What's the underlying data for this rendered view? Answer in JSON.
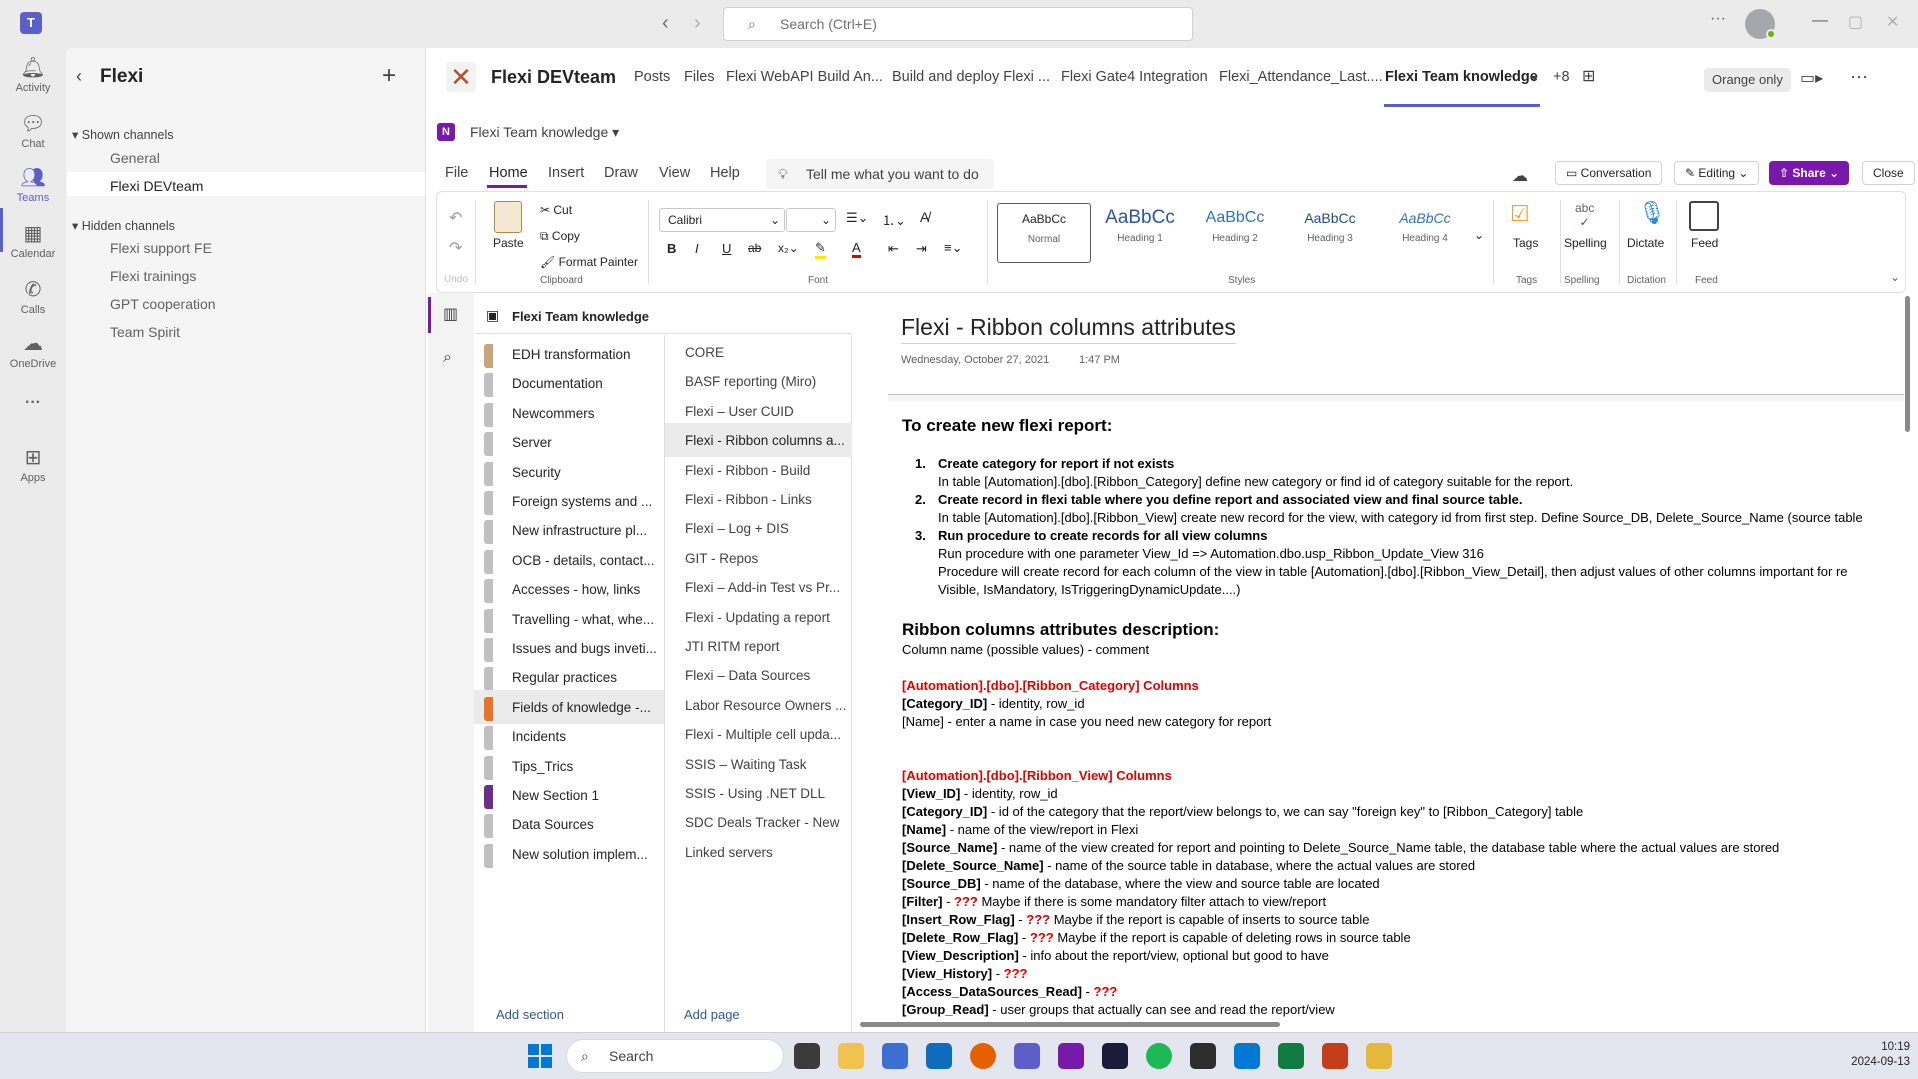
{
  "titlebar": {
    "search_placeholder": "Search (Ctrl+E)",
    "more": "···"
  },
  "rail": [
    {
      "label": "Activity",
      "icon": "bell-icon"
    },
    {
      "label": "Chat",
      "icon": "chat-icon"
    },
    {
      "label": "Teams",
      "icon": "teams-icon"
    },
    {
      "label": "Calendar",
      "icon": "calendar-icon"
    },
    {
      "label": "Calls",
      "icon": "phone-icon"
    },
    {
      "label": "OneDrive",
      "icon": "cloud-icon"
    },
    {
      "label": "···",
      "icon": "more-icon"
    },
    {
      "label": "Apps",
      "icon": "add-app-icon"
    }
  ],
  "team": {
    "name": "Flexi",
    "shown_header": "Shown channels",
    "shown_channels": [
      "General",
      "Flexi DEVteam"
    ],
    "hidden_header": "Hidden channels",
    "hidden_channels": [
      "Flexi support FE",
      "Flexi trainings",
      "GPT cooperation",
      "Team Spirit"
    ]
  },
  "channel": {
    "title": "Flexi DEVteam",
    "tabs": [
      "Posts",
      "Files",
      "Flexi WebAPI Build An...",
      "Build and deploy Flexi ...",
      "Flexi Gate4 Integration",
      "Flexi_Attendance_Last....",
      "Flexi Team knowledge",
      "+8"
    ],
    "orange_only": "Orange only"
  },
  "onenote": {
    "notebook_title": "Flexi Team knowledge",
    "menu": [
      "File",
      "Home",
      "Insert",
      "Draw",
      "View",
      "Help"
    ],
    "tell_me": "Tell me what you want to do",
    "conversation": "Conversation",
    "editing": "Editing",
    "share": "Share",
    "close": "Close",
    "ribbon": {
      "undo_label": "Undo",
      "paste": "Paste",
      "cut": "Cut",
      "copy": "Copy",
      "format_painter": "Format Painter",
      "clipboard": "Clipboard",
      "font_name": "Calibri",
      "font": "Font",
      "styles": [
        {
          "preview": "AaBbCc",
          "name": "Normal"
        },
        {
          "preview": "AaBbCc",
          "name": "Heading 1"
        },
        {
          "preview": "AaBbCc",
          "name": "Heading 2"
        },
        {
          "preview": "AaBbCc",
          "name": "Heading 3"
        },
        {
          "preview": "AaBbCc",
          "name": "Heading 4"
        }
      ],
      "styles_label": "Styles",
      "tags": "Tags",
      "spelling": "Spelling",
      "spelling_icon_text": "abc",
      "dictate": "Dictate",
      "dictation": "Dictation",
      "feed": "Feed"
    },
    "notebook_header": "Flexi Team knowledge",
    "sections": [
      {
        "name": "EDH transformation",
        "color": "#c8a47c"
      },
      {
        "name": "Documentation",
        "color": "#c0c0c0"
      },
      {
        "name": "Newcommers",
        "color": "#c0c0c0"
      },
      {
        "name": "Server",
        "color": "#c0c0c0"
      },
      {
        "name": "Security",
        "color": "#c0c0c0"
      },
      {
        "name": "Foreign systems and ...",
        "color": "#c0c0c0"
      },
      {
        "name": "New infrastructure pl...",
        "color": "#c0c0c0"
      },
      {
        "name": "OCB - details, contact...",
        "color": "#c0c0c0"
      },
      {
        "name": "Accesses - how, links",
        "color": "#c0c0c0"
      },
      {
        "name": "Travelling - what, whe...",
        "color": "#c0c0c0"
      },
      {
        "name": "Issues and bugs inveti...",
        "color": "#c0c0c0"
      },
      {
        "name": "Regular practices",
        "color": "#c0c0c0"
      },
      {
        "name": "Fields of knowledge -...",
        "color": "#e8742a"
      },
      {
        "name": "Incidents",
        "color": "#c0c0c0"
      },
      {
        "name": "Tips_Trics",
        "color": "#c0c0c0"
      },
      {
        "name": "New Section 1",
        "color": "#6b2e8c"
      },
      {
        "name": "Data Sources",
        "color": "#c0c0c0"
      },
      {
        "name": "New solution implem...",
        "color": "#c0c0c0"
      }
    ],
    "pages": [
      "CORE",
      "BASF reporting (Miro)",
      "Flexi – User CUID",
      "Flexi - Ribbon columns a...",
      "Flexi - Ribbon - Build",
      "Flexi - Ribbon - Links",
      "Flexi – Log + DIS",
      "GIT - Repos",
      "Flexi – Add-in Test vs Pr...",
      "Flexi - Updating a report",
      "JTI RITM report",
      "Flexi – Data Sources",
      "Labor Resource Owners ...",
      "Flexi - Multiple cell upda...",
      "SSIS – Waiting Task",
      "SSIS  - Using .NET DLL",
      "SDC Deals Tracker - New",
      "Linked servers"
    ],
    "add_section": "Add section",
    "add_page": "Add page",
    "page": {
      "title": "Flexi - Ribbon columns attributes",
      "date": "Wednesday, October 27, 2021",
      "time": "1:47 PM",
      "h1": "To create new flexi report:",
      "steps": [
        {
          "n": "1.",
          "title": "Create category for report if not exists",
          "lines": [
            "In table [Automation].[dbo].[Ribbon_Category] define new category or find id of category suitable for the report."
          ]
        },
        {
          "n": "2.",
          "title": "Create record in flexi table where you define report and associated view and final source table.",
          "lines": [
            "In table [Automation].[dbo].[Ribbon_View] create new record for the view, with category id from first step. Define Source_DB, Delete_Source_Name (source table"
          ]
        },
        {
          "n": "3.",
          "title": "Run procedure to create records for all view columns",
          "lines": [
            "Run procedure with one parameter View_Id => Automation.dbo.usp_Ribbon_Update_View 316",
            "Procedure will create record for each column of the view in table [Automation].[dbo].[Ribbon_View_Detail], then adjust values of other columns important for re",
            "Visible, IsMandatory, IsTriggeringDynamicUpdate....)"
          ]
        }
      ],
      "h2": "Ribbon columns attributes description:",
      "h2_sub": "Column name (possible values) - comment",
      "cat_header": "[Automation].[dbo].[Ribbon_Category] Columns",
      "cat_rows": [
        {
          "k": "[Category_ID]",
          "v": " - identity, row_id",
          "q": ""
        },
        {
          "k": "",
          "v": "[Name] - enter a name in case you need new category for report",
          "q": ""
        }
      ],
      "view_header": "[Automation].[dbo].[Ribbon_View] Columns",
      "view_rows": [
        {
          "k": "[View_ID]",
          "q": "",
          "v": " - identity, row_id"
        },
        {
          "k": "[Category_ID]",
          "q": "",
          "v": " - id of the category that the report/view belongs to, we can say \"foreign key\" to [Ribbon_Category] table"
        },
        {
          "k": "[Name]",
          "q": "",
          "v": " - name of the view/report in Flexi"
        },
        {
          "k": "[Source_Name]",
          "q": "",
          "v": " - name of the view created for report and pointing to Delete_Source_Name table, the database table where the actual values are stored"
        },
        {
          "k": "[Delete_Source_Name]",
          "q": "",
          "v": " - name of the source table in database, where the actual values are stored"
        },
        {
          "k": "[Source_DB]",
          "q": "",
          "v": " - name of the database, where the view and source table are located"
        },
        {
          "k": "[Filter]",
          "q": "???",
          "v": " Maybe if there is some mandatory filter attach to view/report"
        },
        {
          "k": "[Insert_Row_Flag]",
          "q": "???",
          "v": " Maybe if the report is capable of inserts to source table"
        },
        {
          "k": "[Delete_Row_Flag]",
          "q": "???",
          "v": " Maybe if the report is capable of deleting rows in source table"
        },
        {
          "k": "[View_Description]",
          "q": "",
          "v": " - info about the report/view, optional but good to have"
        },
        {
          "k": "[View_History]",
          "q": "???",
          "v": ""
        },
        {
          "k": "[Access_DataSources_Read]",
          "q": "???",
          "v": ""
        },
        {
          "k": "[Group_Read]",
          "q": "",
          "v": " - user groups that actually can see and read the report/view"
        }
      ]
    }
  },
  "taskbar": {
    "search": "Search",
    "time": "10:19",
    "date": "2024-09-13"
  }
}
